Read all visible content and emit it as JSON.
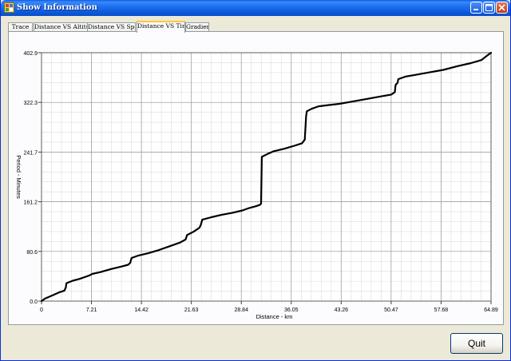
{
  "window": {
    "title": "Show Information"
  },
  "tabs": [
    {
      "label": "Trace",
      "active": false
    },
    {
      "label": "Distance VS Altitude",
      "active": false
    },
    {
      "label": "Distance VS Speed",
      "active": false
    },
    {
      "label": "Distance VS Time",
      "active": true
    },
    {
      "label": "Gradient",
      "active": false
    }
  ],
  "buttons": {
    "quit_label": "Quit"
  },
  "colors": {
    "titlebar": "#0a5ee9",
    "window_bg": "#ece9d8",
    "line": "#000000",
    "major_grid": "#a0a0a0",
    "minor_grid": "#dcdcdc",
    "active_tab_accent": "#ffc83c"
  },
  "chart_data": {
    "type": "line",
    "title": "",
    "xlabel": "Distance - km",
    "ylabel": "Period - Minutes",
    "xlim": [
      0,
      64.89
    ],
    "ylim": [
      0,
      402.9
    ],
    "xticks": [
      0,
      7.21,
      14.42,
      21.63,
      28.84,
      36.05,
      43.26,
      50.47,
      57.68,
      64.89
    ],
    "xtick_labels": [
      "0",
      "7.21",
      "14.42",
      "21.63",
      "28.84",
      "36.05",
      "43.26",
      "50.47",
      "57.68",
      "64.89"
    ],
    "yticks": [
      0,
      80.6,
      161.2,
      241.7,
      322.3,
      402.9
    ],
    "ytick_labels": [
      "0.0",
      "80.6",
      "161.2",
      "241.7",
      "322.3",
      "402.9"
    ],
    "grid": true,
    "minor_grid": true,
    "series": [
      {
        "x": [
          0,
          0.5,
          1.5,
          2.5,
          3.3,
          3.5,
          3.6,
          4.5,
          5.5,
          6.5,
          7.0,
          7.3,
          8.5,
          10.0,
          11.5,
          12.5,
          12.8,
          13.0,
          14.0,
          15.5,
          17.0,
          18.5,
          20.0,
          20.8,
          21.0,
          22.0,
          22.8,
          23.0,
          23.2,
          24.5,
          26.0,
          27.5,
          29.0,
          30.0,
          31.0,
          31.5,
          31.7,
          31.8,
          32.5,
          33.5,
          35.0,
          36.5,
          37.6,
          38.0,
          38.2,
          38.3,
          39.0,
          40.0,
          41.5,
          43.0,
          45.0,
          47.0,
          49.0,
          50.5,
          51.0,
          51.1,
          51.2,
          51.4,
          51.5,
          52.5,
          54.0,
          56.0,
          58.0,
          60.0,
          62.0,
          63.5,
          64.3,
          64.89
        ],
        "y": [
          0,
          4,
          9,
          14,
          17,
          22,
          29,
          33,
          36,
          40,
          42,
          44,
          47,
          52,
          56,
          59,
          62,
          70,
          74,
          78,
          83,
          89,
          95,
          100,
          107,
          113,
          119,
          124,
          132,
          136,
          140,
          143,
          147,
          151,
          154,
          156,
          158,
          234,
          238,
          243,
          247,
          252,
          256,
          262,
          300,
          308,
          312,
          316,
          318,
          320,
          324,
          328,
          332,
          335,
          339,
          350,
          352,
          354,
          360,
          364,
          367,
          371,
          375,
          381,
          386,
          391,
          398,
          402.9
        ]
      }
    ]
  }
}
